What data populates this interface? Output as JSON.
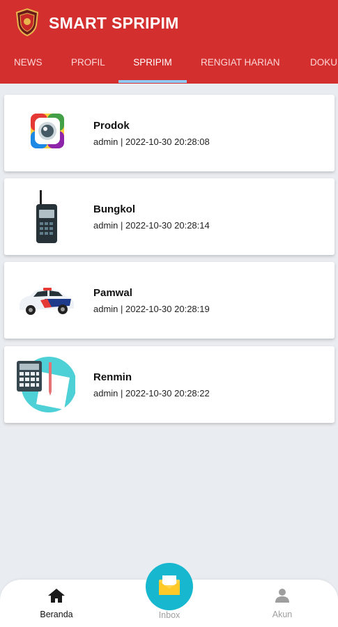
{
  "app": {
    "title": "SMART SPRIPIM",
    "brand_color": "#d32f2f"
  },
  "tabs": [
    {
      "label": "NEWS",
      "active": false
    },
    {
      "label": "PROFIL",
      "active": false
    },
    {
      "label": "SPRIPIM",
      "active": true
    },
    {
      "label": "RENGIAT HARIAN",
      "active": false
    },
    {
      "label": "DOKU",
      "active": false
    }
  ],
  "items": [
    {
      "title": "Prodok",
      "meta": "admin | 2022-10-30 20:28:08",
      "icon": "camera-icon"
    },
    {
      "title": "Bungkol",
      "meta": "admin | 2022-10-30 20:28:14",
      "icon": "walkie-talkie-icon"
    },
    {
      "title": "Pamwal",
      "meta": "admin | 2022-10-30 20:28:19",
      "icon": "police-car-icon"
    },
    {
      "title": "Renmin",
      "meta": "admin | 2022-10-30 20:28:22",
      "icon": "calculator-icon"
    }
  ],
  "bottom_nav": {
    "beranda": "Beranda",
    "inbox": "Inbox",
    "akun": "Akun",
    "active": "Beranda"
  }
}
